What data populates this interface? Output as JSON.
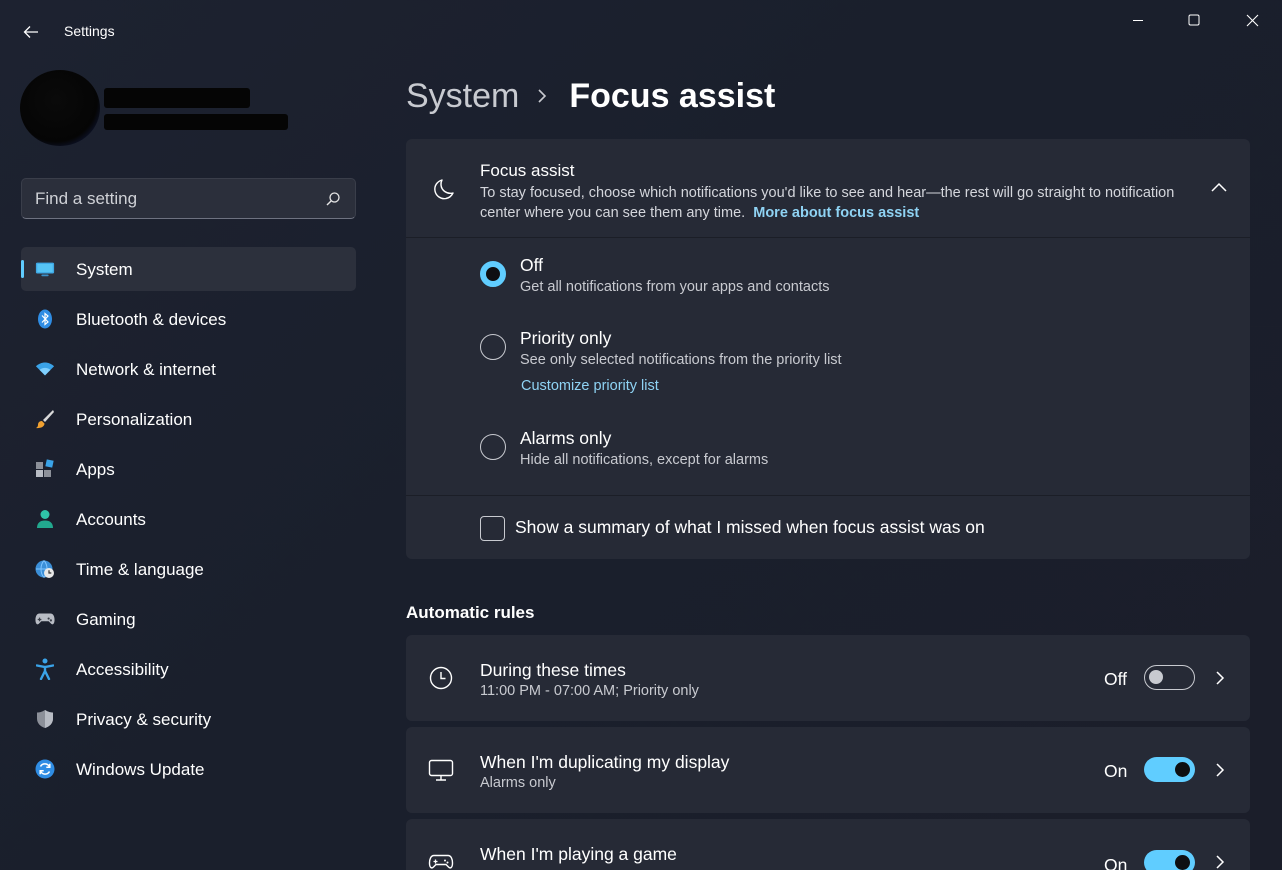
{
  "window": {
    "title": "Settings",
    "accent_color": "#60cdff",
    "background_color": "#1c202c",
    "card_color": "#262a36"
  },
  "search": {
    "placeholder": "Find a setting"
  },
  "sidebar": {
    "items": [
      {
        "label": "System",
        "icon": "monitor-icon",
        "active": true
      },
      {
        "label": "Bluetooth & devices",
        "icon": "bluetooth-icon"
      },
      {
        "label": "Network & internet",
        "icon": "wifi-icon"
      },
      {
        "label": "Personalization",
        "icon": "paintbrush-icon"
      },
      {
        "label": "Apps",
        "icon": "apps-icon"
      },
      {
        "label": "Accounts",
        "icon": "person-icon"
      },
      {
        "label": "Time & language",
        "icon": "globe-clock-icon"
      },
      {
        "label": "Gaming",
        "icon": "gamepad-icon"
      },
      {
        "label": "Accessibility",
        "icon": "accessibility-icon"
      },
      {
        "label": "Privacy & security",
        "icon": "shield-icon"
      },
      {
        "label": "Windows Update",
        "icon": "update-icon"
      }
    ]
  },
  "breadcrumb": {
    "parent": "System",
    "current": "Focus assist"
  },
  "focus_assist": {
    "title": "Focus assist",
    "description": "To stay focused, choose which notifications you'd like to see and hear—the rest will go straight to notification center where you can see them any time.",
    "link": "More about focus assist",
    "options": [
      {
        "label": "Off",
        "sub": "Get all notifications from your apps and contacts",
        "checked": true
      },
      {
        "label": "Priority only",
        "sub": "See only selected notifications from the priority list",
        "link": "Customize priority list",
        "checked": false
      },
      {
        "label": "Alarms only",
        "sub": "Hide all notifications, except for alarms",
        "checked": false
      }
    ],
    "summary_checkbox": {
      "label": "Show a summary of what I missed when focus assist was on",
      "checked": false
    }
  },
  "automatic_rules": {
    "title": "Automatic rules",
    "rules": [
      {
        "title": "During these times",
        "sub": "11:00 PM - 07:00 AM; Priority only",
        "state": "Off",
        "enabled": false,
        "icon": "clock-icon"
      },
      {
        "title": "When I'm duplicating my display",
        "sub": "Alarms only",
        "state": "On",
        "enabled": true,
        "icon": "monitor-icon"
      },
      {
        "title": "When I'm playing a game",
        "sub": "",
        "state": "On",
        "enabled": true,
        "icon": "gamepad-icon"
      }
    ]
  }
}
